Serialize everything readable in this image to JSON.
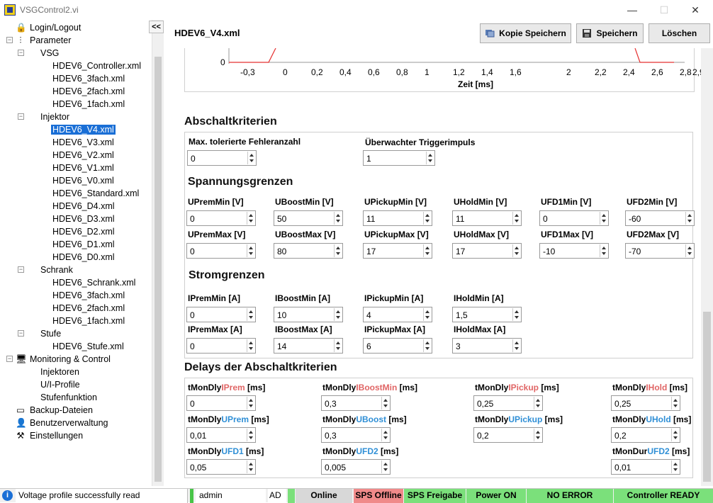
{
  "window": {
    "title": "VSGControl2.vi",
    "minimize": "—",
    "maximize": "☐",
    "close": "✕"
  },
  "tree": {
    "collapse": "<<",
    "items": [
      {
        "label": "Login/Logout",
        "icon": "lock-icon",
        "glyph": "🔒"
      },
      {
        "label": "Parameter",
        "icon": "sliders-icon",
        "glyph": "⫶"
      },
      {
        "label": "VSG"
      },
      {
        "label": "HDEV6_Controller.xml"
      },
      {
        "label": "HDEV6_3fach.xml"
      },
      {
        "label": "HDEV6_2fach.xml"
      },
      {
        "label": "HDEV6_1fach.xml"
      },
      {
        "label": "Injektor"
      },
      {
        "label": "HDEV6_V4.xml",
        "selected": true
      },
      {
        "label": "HDEV6_V3.xml"
      },
      {
        "label": "HDEV6_V2.xml"
      },
      {
        "label": "HDEV6_V1.xml"
      },
      {
        "label": "HDEV6_V0.xml"
      },
      {
        "label": "HDEV6_Standard.xml"
      },
      {
        "label": "HDEV6_D4.xml"
      },
      {
        "label": "HDEV6_D3.xml"
      },
      {
        "label": "HDEV6_D2.xml"
      },
      {
        "label": "HDEV6_D1.xml"
      },
      {
        "label": "HDEV6_D0.xml"
      },
      {
        "label": "Schrank"
      },
      {
        "label": "HDEV6_Schrank.xml"
      },
      {
        "label": "HDEV6_3fach.xml"
      },
      {
        "label": "HDEV6_2fach.xml"
      },
      {
        "label": "HDEV6_1fach.xml"
      },
      {
        "label": "Stufe"
      },
      {
        "label": "HDEV6_Stufe.xml"
      },
      {
        "label": "Monitoring & Control",
        "icon": "monitor-icon",
        "glyph": "🖥"
      },
      {
        "label": "Injektoren"
      },
      {
        "label": "U/I-Profile"
      },
      {
        "label": "Stufenfunktion"
      },
      {
        "label": "Backup-Dateien",
        "icon": "drive-icon",
        "glyph": "▭"
      },
      {
        "label": "Benutzerverwaltung",
        "icon": "user-icon",
        "glyph": "👤"
      },
      {
        "label": "Einstellungen",
        "icon": "tools-icon",
        "glyph": "⚒"
      }
    ]
  },
  "header": {
    "file": "HDEV6_V4.xml",
    "buttons": {
      "copy_save": "Kopie Speichern",
      "save": "Speichern",
      "delete": "Löschen"
    }
  },
  "chart": {
    "y_tick": "0",
    "x_ticks": [
      "-0,3",
      "0",
      "0,2",
      "0,4",
      "0,6",
      "0,8",
      "1",
      "1,2",
      "1,4",
      "1,6",
      "2",
      "2,2",
      "2,4",
      "2,6",
      "2,8",
      "2,9"
    ],
    "x_label": "Zeit [ms]"
  },
  "sections": {
    "abschalt": {
      "title": "Abschaltkriterien",
      "max_fehler_label": "Max. tolerierte Fehleranzahl",
      "max_fehler_value": "0",
      "trigger_label": "Überwachter Triggerimpuls",
      "trigger_value": "1"
    },
    "spannung": {
      "title": "Spannungsgrenzen",
      "min": [
        {
          "label": "UPremMin [V]",
          "value": "0"
        },
        {
          "label": "UBoostMin [V]",
          "value": "50"
        },
        {
          "label": "UPickupMin [V]",
          "value": "11"
        },
        {
          "label": "UHoldMin [V]",
          "value": "11"
        },
        {
          "label": "UFD1Min [V]",
          "value": "0"
        },
        {
          "label": "UFD2Min [V]",
          "value": "-60"
        }
      ],
      "max": [
        {
          "label": "UPremMax [V]",
          "value": "0"
        },
        {
          "label": "UBoostMax [V]",
          "value": "80"
        },
        {
          "label": "UPickupMax [V]",
          "value": "17"
        },
        {
          "label": "UHoldMax [V]",
          "value": "17"
        },
        {
          "label": "UFD1Max [V]",
          "value": "-10"
        },
        {
          "label": "UFD2Max [V]",
          "value": "-70"
        }
      ]
    },
    "strom": {
      "title": "Stromgrenzen",
      "min": [
        {
          "label": "IPremMin [A]",
          "value": "0"
        },
        {
          "label": "IBoostMin [A]",
          "value": "10"
        },
        {
          "label": "IPickupMin [A]",
          "value": "4"
        },
        {
          "label": "IHoldMin [A]",
          "value": "1,5"
        }
      ],
      "max": [
        {
          "label": "IPremMax [A]",
          "value": "0"
        },
        {
          "label": "IBoostMax [A]",
          "value": "14"
        },
        {
          "label": "IPickupMax [A]",
          "value": "6"
        },
        {
          "label": "IHoldMax [A]",
          "value": "3"
        }
      ]
    },
    "delays": {
      "title": "Delays der Abschaltkriterien",
      "row1": [
        {
          "pre": "tMonDly",
          "mid": "IPrem",
          "post": " [ms]",
          "color": "red",
          "value": "0"
        },
        {
          "pre": "tMonDly",
          "mid": "IBoostMin",
          "post": " [ms]",
          "color": "red",
          "value": "0,3"
        },
        {
          "pre": "tMonDly",
          "mid": "IPickup",
          "post": " [ms]",
          "color": "red",
          "value": "0,25"
        },
        {
          "pre": "tMonDly",
          "mid": "IHold",
          "post": " [ms]",
          "color": "red",
          "value": "0,25"
        }
      ],
      "row2": [
        {
          "pre": "tMonDly",
          "mid": "UPrem",
          "post": " [ms]",
          "color": "blue",
          "value": "0,01"
        },
        {
          "pre": "tMonDly",
          "mid": "UBoost",
          "post": " [ms]",
          "color": "blue",
          "value": "0,3"
        },
        {
          "pre": "tMonDly",
          "mid": "UPickup",
          "post": " [ms]",
          "color": "blue",
          "value": "0,2"
        },
        {
          "pre": "tMonDly",
          "mid": "UHold",
          "post": " [ms]",
          "color": "blue",
          "value": "0,2"
        }
      ],
      "row3": [
        {
          "pre": "tMonDly",
          "mid": "UFD1",
          "post": " [ms]",
          "color": "blue",
          "value": "0,05"
        },
        {
          "pre": "tMonDly",
          "mid": "UFD2",
          "post": " [ms]",
          "color": "blue",
          "value": "0,005"
        },
        {
          "pre": "tMonDur",
          "mid": "UFD2",
          "post": " [ms]",
          "color": "blue",
          "value": "0,01"
        }
      ]
    }
  },
  "status": {
    "message": "Voltage profile successfully read",
    "user": "admin",
    "ad": "AD",
    "online": "Online",
    "sps_offline": "SPS Offline",
    "sps_freigabe": "SPS Freigabe",
    "power_on": "Power ON",
    "no_error": "NO ERROR",
    "controller_ready": "Controller READY",
    "colors": {
      "red": "#f08a8a",
      "green": "#7be07b",
      "gray": "#d8d8d8",
      "user_bar": "#47c447"
    }
  }
}
